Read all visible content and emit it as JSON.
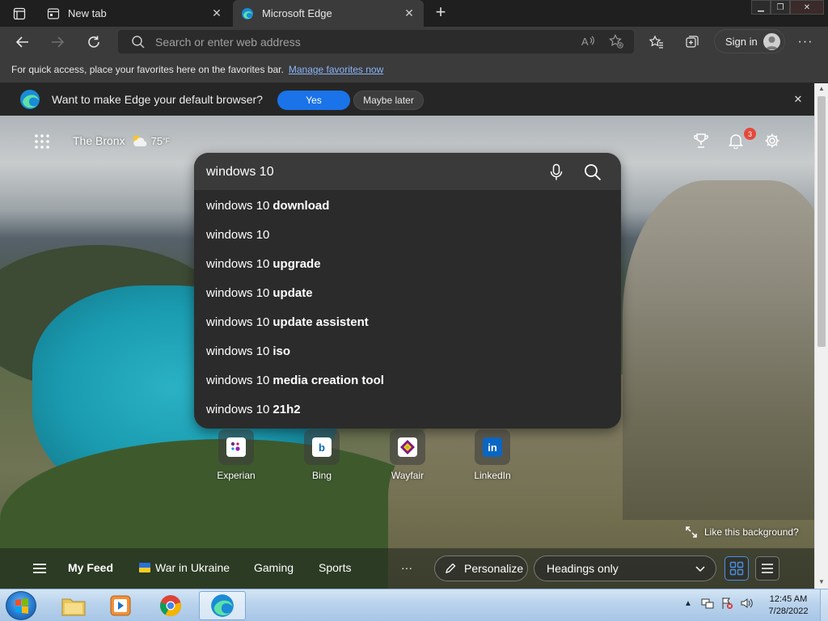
{
  "tabs": [
    {
      "title": "New tab",
      "icon": "newtab-page-icon",
      "active": false
    },
    {
      "title": "Microsoft Edge",
      "icon": "edge-logo-icon",
      "active": true
    }
  ],
  "toolbar": {
    "address_placeholder": "Search or enter web address",
    "signin_label": "Sign in"
  },
  "favorites_bar": {
    "message": "For quick access, place your favorites here on the favorites bar.",
    "link": "Manage favorites now"
  },
  "default_prompt": {
    "message": "Want to make Edge your default browser?",
    "yes_label": "Yes",
    "later_label": "Maybe later"
  },
  "ntp": {
    "location": "The Bronx",
    "temperature": "75",
    "temp_unit": "°F",
    "notification_count": "3"
  },
  "search": {
    "query": "windows 10",
    "suggestions": [
      {
        "prefix": "windows 10",
        "bold": "download"
      },
      {
        "prefix": "windows 10",
        "bold": ""
      },
      {
        "prefix": "windows 10",
        "bold": "upgrade"
      },
      {
        "prefix": "windows 10",
        "bold": "update"
      },
      {
        "prefix": "windows 10",
        "bold": "update assistent"
      },
      {
        "prefix": "windows 10",
        "bold": "iso"
      },
      {
        "prefix": "windows 10",
        "bold": "media creation tool"
      },
      {
        "prefix": "windows 10",
        "bold": "21h2"
      }
    ]
  },
  "quick_links": [
    {
      "label": "Experian",
      "color": "#6b2c91"
    },
    {
      "label": "Bing",
      "color": "#0a66c2"
    },
    {
      "label": "Wayfair",
      "color": "#7f187f"
    },
    {
      "label": "LinkedIn",
      "color": "#0a66c2"
    }
  ],
  "background": {
    "like_label": "Like this background?"
  },
  "feed": {
    "my_feed": "My Feed",
    "items": [
      "War in Ukraine",
      "Gaming",
      "Sports"
    ],
    "more": "···",
    "personalize": "Personalize",
    "headings_select": "Headings only"
  },
  "taskbar": {
    "time": "12:45 AM",
    "date": "7/28/2022"
  },
  "colors": {
    "accent": "#1a73e8",
    "link": "#8ab4f8",
    "badge": "#e5483a"
  }
}
